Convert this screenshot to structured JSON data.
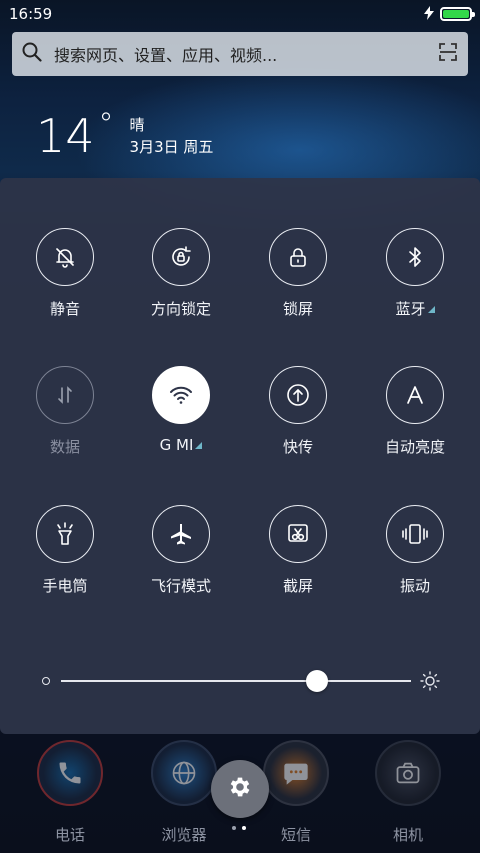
{
  "status_bar": {
    "time": "16:59",
    "charging_icon": "bolt-icon",
    "battery_color": "#33d74a"
  },
  "search": {
    "placeholder": "搜索网页、设置、应用、视频..."
  },
  "weather": {
    "temperature": "14",
    "degree_symbol": "°",
    "condition": "晴",
    "date": "3月3日 周五"
  },
  "quick_settings": {
    "row1": [
      {
        "label": "静音",
        "icon": "bell-off-icon"
      },
      {
        "label": "方向锁定",
        "icon": "rotation-lock-icon"
      },
      {
        "label": "锁屏",
        "icon": "padlock-icon"
      },
      {
        "label": "蓝牙",
        "icon": "bluetooth-icon"
      }
    ],
    "row2": [
      {
        "label": "数据",
        "icon": "mobile-data-icon"
      },
      {
        "label": "G   MI",
        "icon": "wifi-icon"
      },
      {
        "label": "快传",
        "icon": "quick-transfer-icon"
      },
      {
        "label": "自动亮度",
        "icon": "auto-brightness-icon"
      }
    ],
    "row3": [
      {
        "label": "手电筒",
        "icon": "flashlight-icon"
      },
      {
        "label": "飞行模式",
        "icon": "airplane-icon"
      },
      {
        "label": "截屏",
        "icon": "screenshot-icon"
      },
      {
        "label": "振动",
        "icon": "vibrate-icon"
      }
    ],
    "brightness_level": 0.73,
    "accent_color": "#6fb7c9"
  },
  "dock": {
    "items": [
      {
        "label": "电话",
        "icon": "phone-icon"
      },
      {
        "label": "浏览器",
        "icon": "browser-icon"
      },
      {
        "label": "短信",
        "icon": "messages-icon"
      },
      {
        "label": "相机",
        "icon": "camera-icon"
      }
    ]
  },
  "settings_button": {
    "icon": "gear-icon"
  }
}
